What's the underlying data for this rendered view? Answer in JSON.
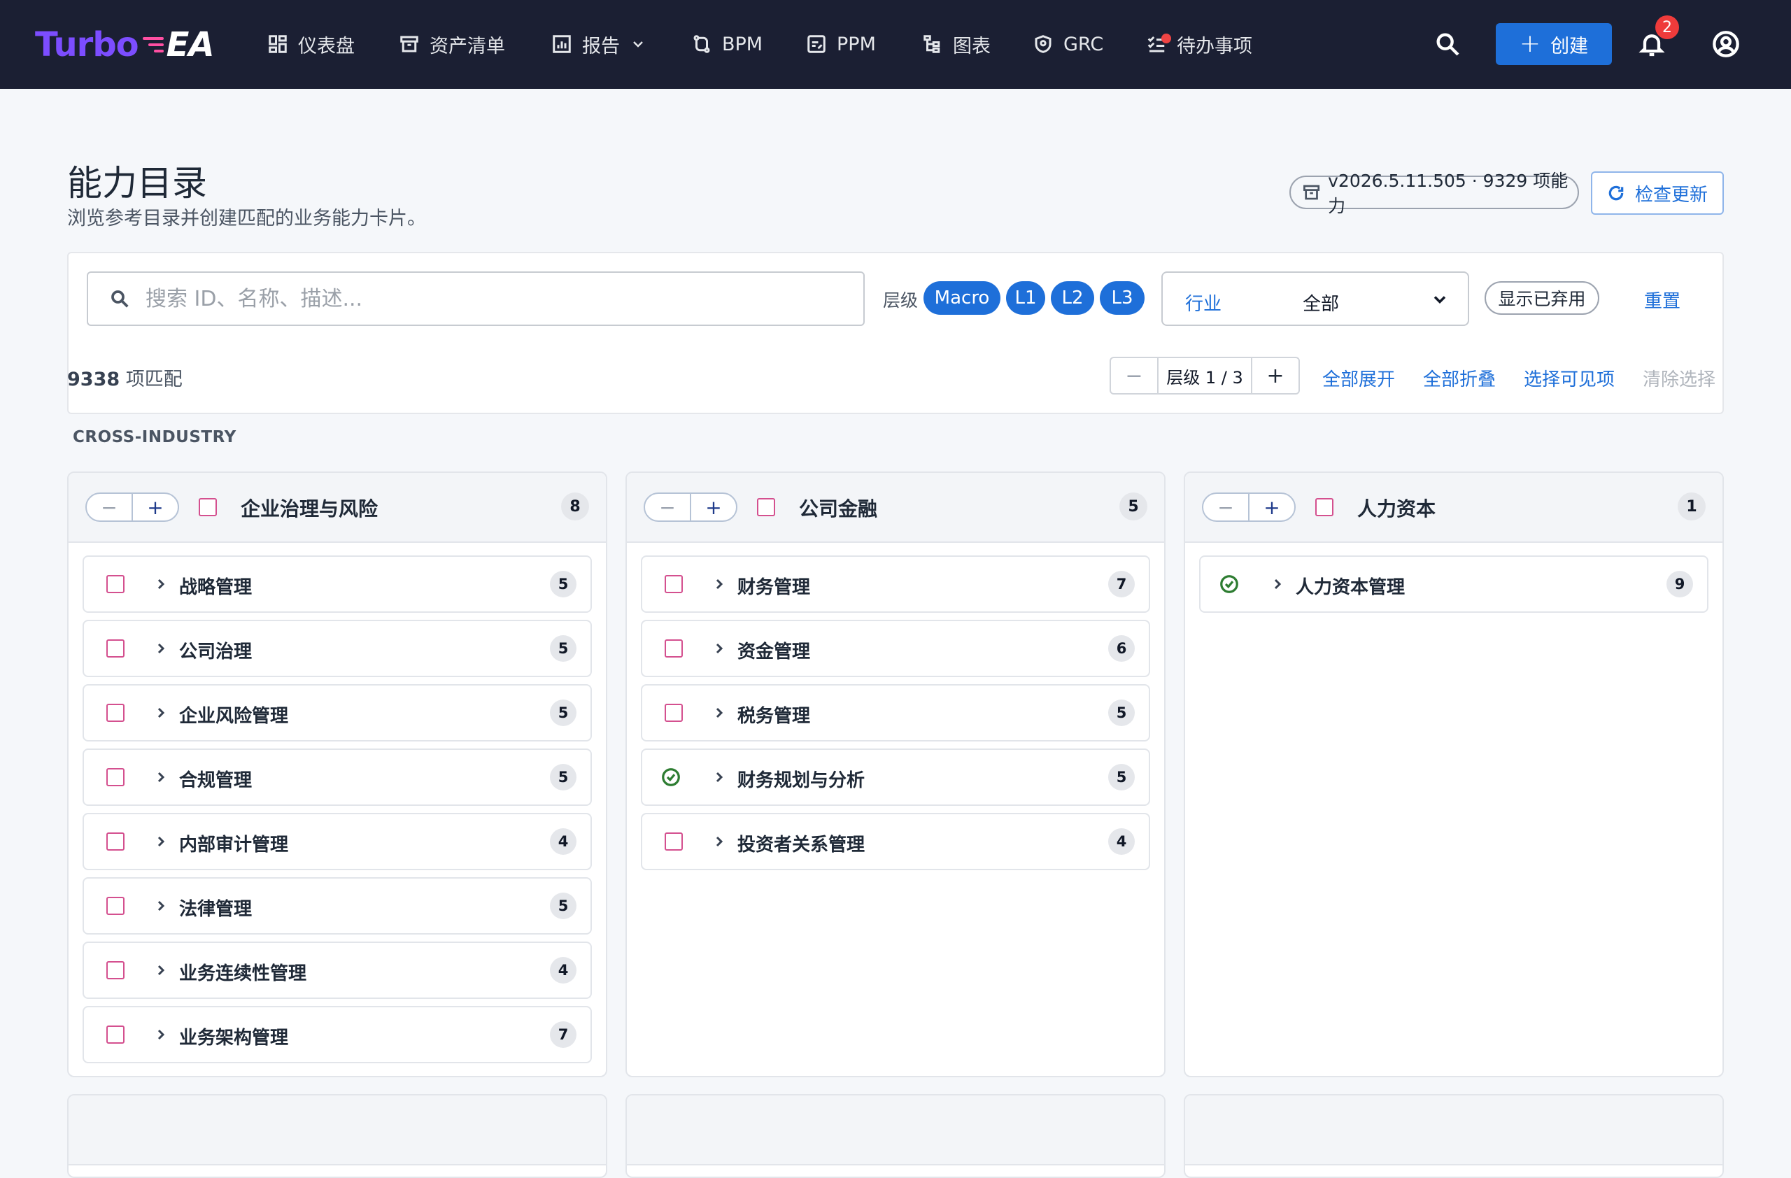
{
  "app": {
    "logo_part1": "Turbo",
    "logo_part2": "EA",
    "accent_color": "#1e6fd9",
    "nav_bg_color": "#1b1f33"
  },
  "nav": {
    "items": [
      {
        "label": "仪表盘",
        "icon": "dashboard-icon"
      },
      {
        "label": "资产清单",
        "icon": "archive-icon"
      },
      {
        "label": "报告",
        "icon": "report-icon"
      },
      {
        "label": "BPM",
        "icon": "process-icon"
      },
      {
        "label": "PPM",
        "icon": "portfolio-icon"
      },
      {
        "label": "图表",
        "icon": "diagram-icon"
      },
      {
        "label": "GRC",
        "icon": "shield-icon"
      },
      {
        "label": "待办事项",
        "icon": "checklist-icon"
      }
    ],
    "create_label": "创建",
    "notification_count": "2"
  },
  "header": {
    "title": "能力目录",
    "subtitle": "浏览参考目录并创建匹配的业务能力卡片。",
    "version": "v2026.5.11.505 · 9329 项能力",
    "check_update": "检查更新"
  },
  "filters": {
    "search_placeholder": "搜索 ID、名称、描述...",
    "level_label": "层级",
    "levels": [
      "Macro",
      "L1",
      "L2",
      "L3"
    ],
    "industry_label": "行业",
    "industry_value": "全部",
    "show_deprecated": "显示已弃用",
    "reset": "重置"
  },
  "toolbar": {
    "match_count": "9338",
    "match_suffix": " 项匹配",
    "level_minus": "−",
    "level_display": "层级 1 / 3",
    "level_plus": "+",
    "expand_all": "全部展开",
    "collapse_all": "全部折叠",
    "select_visible": "选择可见项",
    "clear_selection": "清除选择"
  },
  "section": {
    "label": "CROSS-INDUSTRY"
  },
  "cards": [
    {
      "title": "企业治理与风险",
      "count": "8",
      "rows": [
        {
          "label": "战略管理",
          "count": "5",
          "selected": false
        },
        {
          "label": "公司治理",
          "count": "5",
          "selected": false
        },
        {
          "label": "企业风险管理",
          "count": "5",
          "selected": false
        },
        {
          "label": "合规管理",
          "count": "5",
          "selected": false
        },
        {
          "label": "内部审计管理",
          "count": "4",
          "selected": false
        },
        {
          "label": "法律管理",
          "count": "5",
          "selected": false
        },
        {
          "label": "业务连续性管理",
          "count": "4",
          "selected": false
        },
        {
          "label": "业务架构管理",
          "count": "7",
          "selected": false
        }
      ]
    },
    {
      "title": "公司金融",
      "count": "5",
      "rows": [
        {
          "label": "财务管理",
          "count": "7",
          "selected": false
        },
        {
          "label": "资金管理",
          "count": "6",
          "selected": false
        },
        {
          "label": "税务管理",
          "count": "5",
          "selected": false
        },
        {
          "label": "财务规划与分析",
          "count": "5",
          "selected": true
        },
        {
          "label": "投资者关系管理",
          "count": "4",
          "selected": false
        }
      ]
    },
    {
      "title": "人力资本",
      "count": "1",
      "rows": [
        {
          "label": "人力资本管理",
          "count": "9",
          "selected": true
        }
      ]
    }
  ]
}
